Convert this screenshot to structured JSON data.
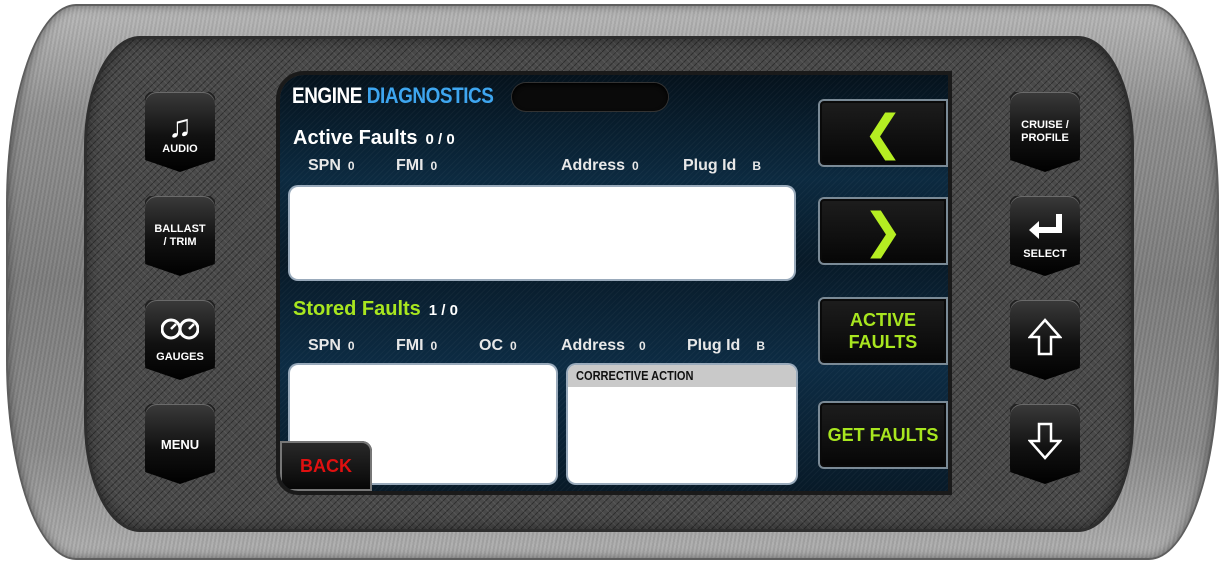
{
  "screen": {
    "title_part1": "ENGINE",
    "title_part2": "DIAGNOSTICS",
    "active": {
      "heading": "Active Faults",
      "count": "0 / 0",
      "spn_label": "SPN",
      "spn_value": "0",
      "fmi_label": "FMI",
      "fmi_value": "0",
      "address_label": "Address",
      "address_value": "0",
      "plug_label": "Plug Id",
      "plug_value": "B"
    },
    "stored": {
      "heading": "Stored Faults",
      "count": "1 / 0",
      "spn_label": "SPN",
      "spn_value": "0",
      "fmi_label": "FMI",
      "fmi_value": "0",
      "oc_label": "OC",
      "oc_value": "0",
      "address_label": "Address",
      "address_value": "0",
      "plug_label": "Plug Id",
      "plug_value": "B"
    },
    "corrective_action_label": "CORRECTIVE ACTION",
    "back_label": "BACK",
    "prev_glyph": "❮",
    "next_glyph": "❯",
    "active_faults_button": "ACTIVE FAULTS",
    "get_faults_button": "GET FAULTS"
  },
  "left_buttons": {
    "audio": "AUDIO",
    "ballast": "BALLAST / TRIM",
    "gauges": "GAUGES",
    "menu": "MENU"
  },
  "right_buttons": {
    "cruise": "CRUISE / PROFILE",
    "select": "SELECT"
  },
  "colors": {
    "accent_blue": "#3ea6f0",
    "accent_green": "#a8e61f",
    "back_red": "#e01010"
  },
  "icons": {
    "audio": "music-note-icon",
    "select": "enter-arrow-icon",
    "gauges": "gauges-icon",
    "up": "up-arrow-icon",
    "down": "down-arrow-icon"
  }
}
